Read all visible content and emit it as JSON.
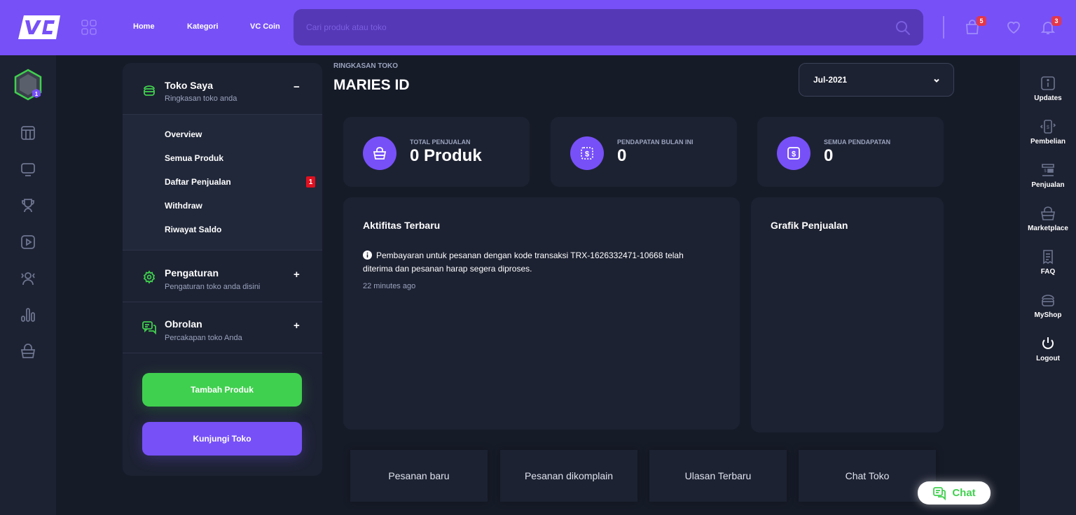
{
  "header": {
    "logo_text": "VC",
    "nav": [
      "Home",
      "Kategori",
      "VC Coin"
    ],
    "search": {
      "placeholder": "Cari produk atau toko",
      "value": ""
    },
    "cart_count": "5",
    "notification_count": "3",
    "brand_color": "#7750f8"
  },
  "left_rail": {
    "avatar_level": "1",
    "icons": [
      "newsfeed-icon",
      "overview-icon",
      "trophy-icon",
      "video-icon",
      "members-icon",
      "stats-icon",
      "marketplace-icon"
    ]
  },
  "sidebar": {
    "toko_saya": {
      "title": "Toko Saya",
      "subtitle": "Ringkasan toko anda",
      "toggle": "−"
    },
    "sub_items": [
      {
        "label": "Overview"
      },
      {
        "label": "Semua Produk"
      },
      {
        "label": "Daftar Penjualan",
        "badge": "1"
      },
      {
        "label": "Withdraw"
      },
      {
        "label": "Riwayat Saldo"
      }
    ],
    "pengaturan": {
      "title": "Pengaturan",
      "subtitle": "Pengaturan toko anda disini",
      "toggle": "+"
    },
    "obrolan": {
      "title": "Obrolan",
      "subtitle": "Percakapan toko Anda",
      "toggle": "+"
    },
    "add_product_label": "Tambah Produk",
    "visit_shop_label": "Kunjungi Toko"
  },
  "main": {
    "breadcrumb": "RINGKASAN TOKO",
    "title": "MARIES ID",
    "month_select": "Jul-2021",
    "stats": [
      {
        "label": "TOTAL PENJUALAN",
        "value": "0 Produk"
      },
      {
        "label": "PENDAPATAN BULAN INI",
        "value": "0"
      },
      {
        "label": "SEMUA PENDAPATAN",
        "value": "0"
      }
    ],
    "activity": {
      "title": "Aktifitas Terbaru",
      "message": "Pembayaran untuk pesanan dengan kode transaksi TRX-1626332471-10668 telah diterima dan pesanan harap segera diproses.",
      "time": "22 minutes ago"
    },
    "chart_title": "Grafik Penjualan",
    "tiles": [
      "Pesanan baru",
      "Pesanan dikomplain",
      "Ulasan Terbaru",
      "Chat Toko"
    ]
  },
  "right_rail": [
    {
      "label": "Updates"
    },
    {
      "label": "Pembelian"
    },
    {
      "label": "Penjualan"
    },
    {
      "label": "Marketplace"
    },
    {
      "label": "FAQ"
    },
    {
      "label": "MyShop"
    },
    {
      "label": "Logout"
    }
  ],
  "chat_button": "Chat"
}
